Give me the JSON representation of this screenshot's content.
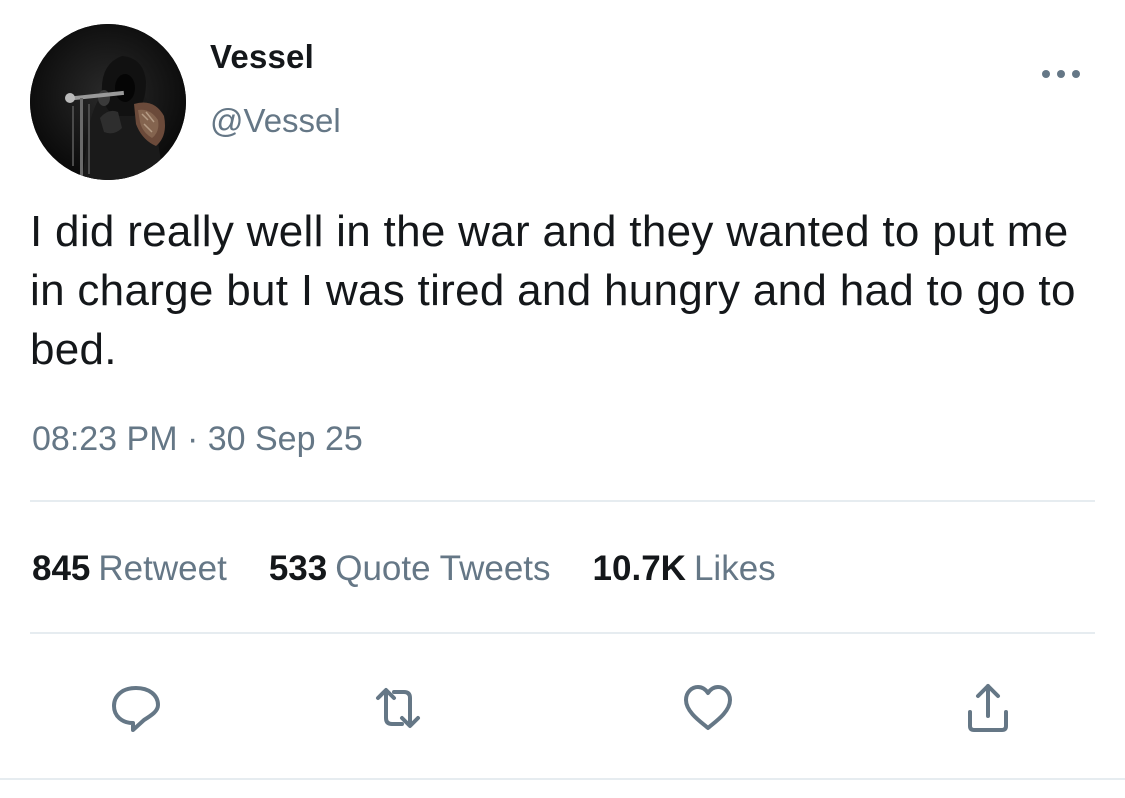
{
  "tweet": {
    "author": {
      "display_name": "Vessel",
      "handle": "@Vessel",
      "avatar_icon": "hooded-figure-microphone-avatar"
    },
    "text": "I did really well in the war and they wanted to put me in charge but I was tired and hungry and had to go to bed.",
    "timestamp": "08:23 PM · 30 Sep 25",
    "stats": {
      "retweets": {
        "count": "845",
        "label": "Retweet"
      },
      "quote_tweets": {
        "count": "533",
        "label": "Quote Tweets"
      },
      "likes": {
        "count": "10.7K",
        "label": "Likes"
      }
    },
    "actions": [
      {
        "name": "reply",
        "icon": "reply-icon"
      },
      {
        "name": "retweet",
        "icon": "retweet-icon"
      },
      {
        "name": "like",
        "icon": "heart-icon"
      },
      {
        "name": "share",
        "icon": "share-icon"
      }
    ]
  },
  "colors": {
    "text_primary": "#14171a",
    "text_secondary": "#657786",
    "divider": "#e6ecf0",
    "icon": "#657786"
  }
}
